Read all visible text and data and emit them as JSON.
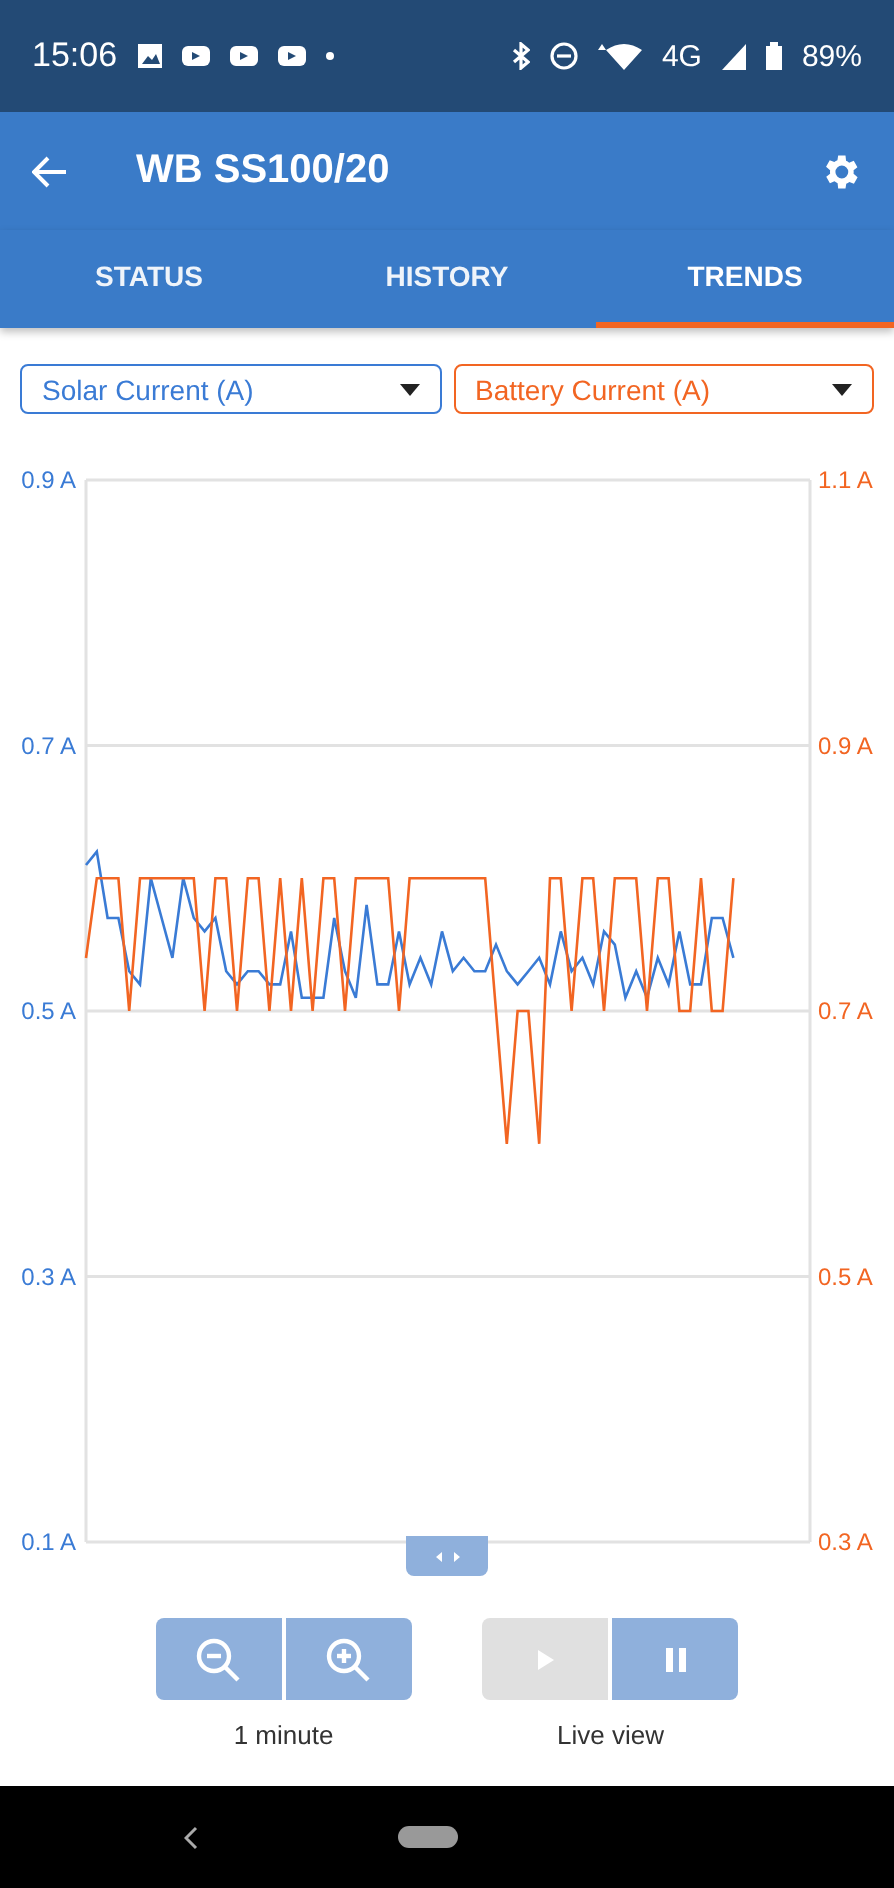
{
  "status_bar": {
    "time": "15:06",
    "network": "4G",
    "battery": "89%"
  },
  "header": {
    "title": "WB SS100/20"
  },
  "tabs": [
    {
      "label": "STATUS",
      "selected": false
    },
    {
      "label": "HISTORY",
      "selected": false
    },
    {
      "label": "TRENDS",
      "selected": true
    }
  ],
  "chart": {
    "chart_data": {
      "type": "line",
      "grid": true,
      "ylim": [
        0.1,
        0.9
      ],
      "yticks": [
        {
          "value": 0.9,
          "label": "0.9 A"
        },
        {
          "value": 0.7,
          "label": "0.7 A"
        },
        {
          "value": 0.5,
          "label": "0.5 A"
        },
        {
          "value": 0.3,
          "label": "0.3 A"
        },
        {
          "value": 0.1,
          "label": "0.1 A"
        }
      ],
      "y2lim": [
        0.3,
        1.1
      ],
      "y2ticks": [
        {
          "value": 1.1,
          "label": "1.1 A"
        },
        {
          "value": 0.9,
          "label": "0.9 A"
        },
        {
          "value": 0.7,
          "label": "0.7 A"
        },
        {
          "value": 0.5,
          "label": "0.5 A"
        },
        {
          "value": 0.3,
          "label": "0.3 A"
        }
      ],
      "series": [
        {
          "name": "Solar Current (A)",
          "color": "#3a7bd5",
          "values": [
            0.61,
            0.62,
            0.57,
            0.57,
            0.53,
            0.52,
            0.6,
            0.57,
            0.54,
            0.6,
            0.57,
            0.56,
            0.57,
            0.53,
            0.52,
            0.53,
            0.53,
            0.52,
            0.52,
            0.56,
            0.51,
            0.51,
            0.51,
            0.57,
            0.53,
            0.51,
            0.58,
            0.52,
            0.52,
            0.56,
            0.52,
            0.54,
            0.52,
            0.56,
            0.53,
            0.54,
            0.53,
            0.53,
            0.55,
            0.53,
            0.52,
            0.53,
            0.54,
            0.52,
            0.56,
            0.53,
            0.54,
            0.52,
            0.56,
            0.55,
            0.51,
            0.53,
            0.51,
            0.54,
            0.52,
            0.56,
            0.52,
            0.52,
            0.57,
            0.57,
            0.54
          ]
        },
        {
          "name": "Battery Current (A)",
          "color": "#f26522",
          "axis": "y2",
          "values": [
            0.74,
            0.8,
            0.8,
            0.8,
            0.7,
            0.8,
            0.8,
            0.8,
            0.8,
            0.8,
            0.8,
            0.7,
            0.8,
            0.8,
            0.7,
            0.8,
            0.8,
            0.7,
            0.8,
            0.7,
            0.8,
            0.7,
            0.8,
            0.8,
            0.7,
            0.8,
            0.8,
            0.8,
            0.8,
            0.7,
            0.8,
            0.8,
            0.8,
            0.8,
            0.8,
            0.8,
            0.8,
            0.8,
            0.7,
            0.6,
            0.7,
            0.7,
            0.6,
            0.8,
            0.8,
            0.7,
            0.8,
            0.8,
            0.7,
            0.8,
            0.8,
            0.8,
            0.7,
            0.8,
            0.8,
            0.7,
            0.7,
            0.8,
            0.7,
            0.7,
            0.8
          ]
        }
      ]
    }
  },
  "controls": [
    {
      "caption": "1 minute",
      "buttons": [
        {
          "kind": "zoom-out",
          "disabled": false
        },
        {
          "kind": "zoom-in",
          "disabled": false
        }
      ]
    },
    {
      "caption": "Live view",
      "buttons": [
        {
          "kind": "play",
          "disabled": true
        },
        {
          "kind": "pause",
          "disabled": false
        }
      ]
    }
  ]
}
